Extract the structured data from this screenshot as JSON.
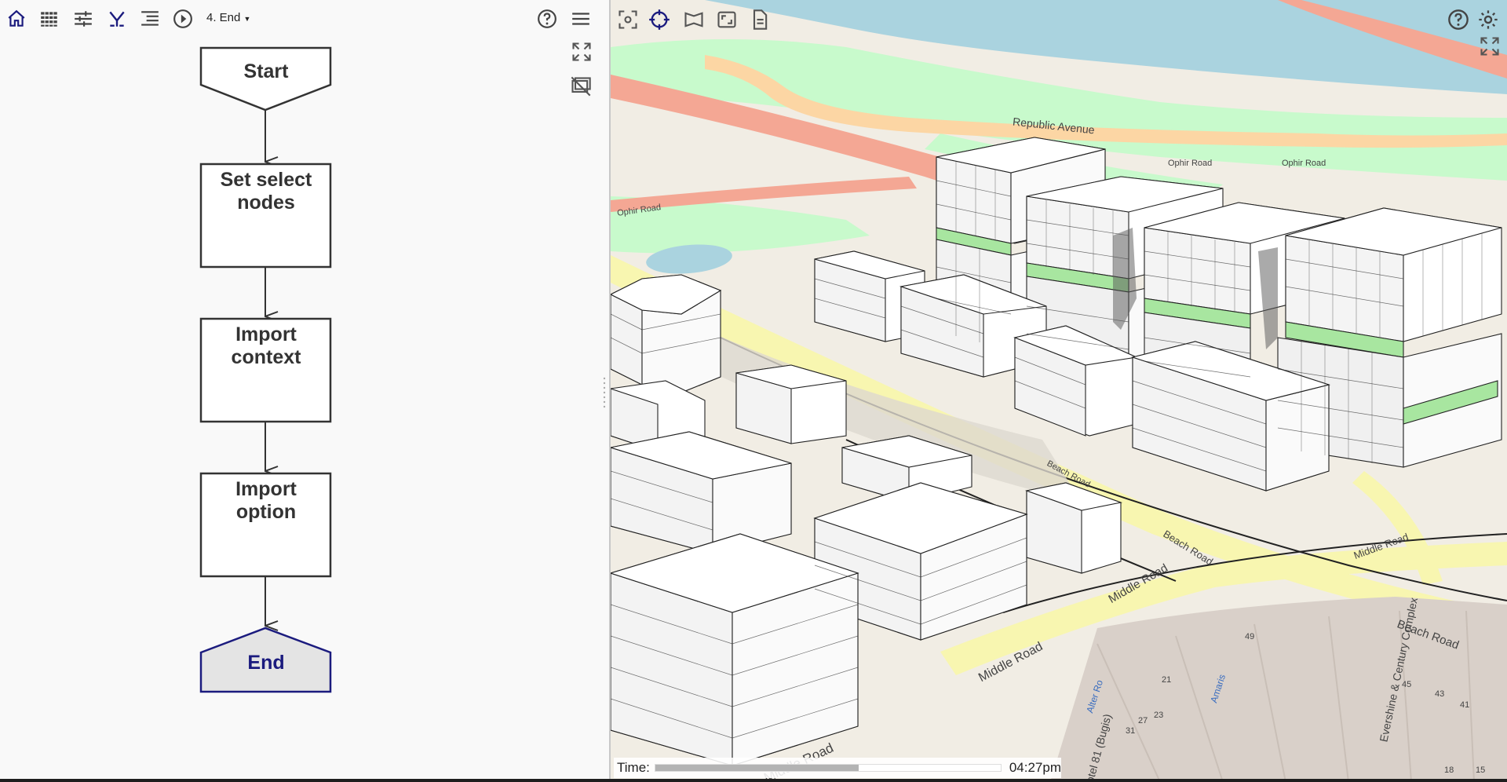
{
  "toolbar": {
    "node_selector": "4. End",
    "icons": [
      "home-icon",
      "grid-icon",
      "sliders-icon",
      "merge-icon",
      "list-icon",
      "play-icon"
    ]
  },
  "flowchart": {
    "nodes": [
      {
        "id": "start",
        "label": "Start",
        "shape": "pentagon-down"
      },
      {
        "id": "set-select-nodes",
        "label": "Set select nodes",
        "shape": "rect"
      },
      {
        "id": "import-context",
        "label": "Import context",
        "shape": "rect"
      },
      {
        "id": "import-option",
        "label": "Import option",
        "shape": "rect"
      },
      {
        "id": "end",
        "label": "End",
        "shape": "pentagon-up",
        "selected": true
      }
    ],
    "lines": {
      "set1": "Set select",
      "set2": "nodes",
      "ctx1": "Import",
      "ctx2": "context",
      "opt1": "Import",
      "opt2": "option"
    }
  },
  "viewer": {
    "map_labels": {
      "republic": "Republic Avenue",
      "ophir1": "Ophir Road",
      "ophir2": "Ophir Road",
      "ophir3": "Ophir Road",
      "beach1": "Beach Road",
      "beach2": "Beach Road",
      "beach3": "Beach Road",
      "middle1": "Middle Road",
      "middle2": "Middle Road",
      "middle3": "Middle Road",
      "middle4": "Middle Road",
      "evershine": "Evershine & Century Complex",
      "hotel": "Hotel 81 (Bugis)",
      "alter": "Alter Ro",
      "amaris": "Amaris",
      "num49": "49",
      "num45": "45",
      "num43": "43",
      "num41": "41",
      "num21": "21",
      "num23": "23",
      "num27": "27",
      "num31": "31",
      "num18": "18",
      "num15": "15"
    },
    "time": {
      "label": "Time:",
      "value": "04:27pm",
      "progress": 0.59
    }
  },
  "colors": {
    "water": "#aad3df",
    "park": "#c8facc",
    "road_major": "#f4a794",
    "road_yellow": "#f8f6b0",
    "land": "#f1ede4",
    "building": "#ffffff",
    "accent": "#1b1b7e"
  }
}
